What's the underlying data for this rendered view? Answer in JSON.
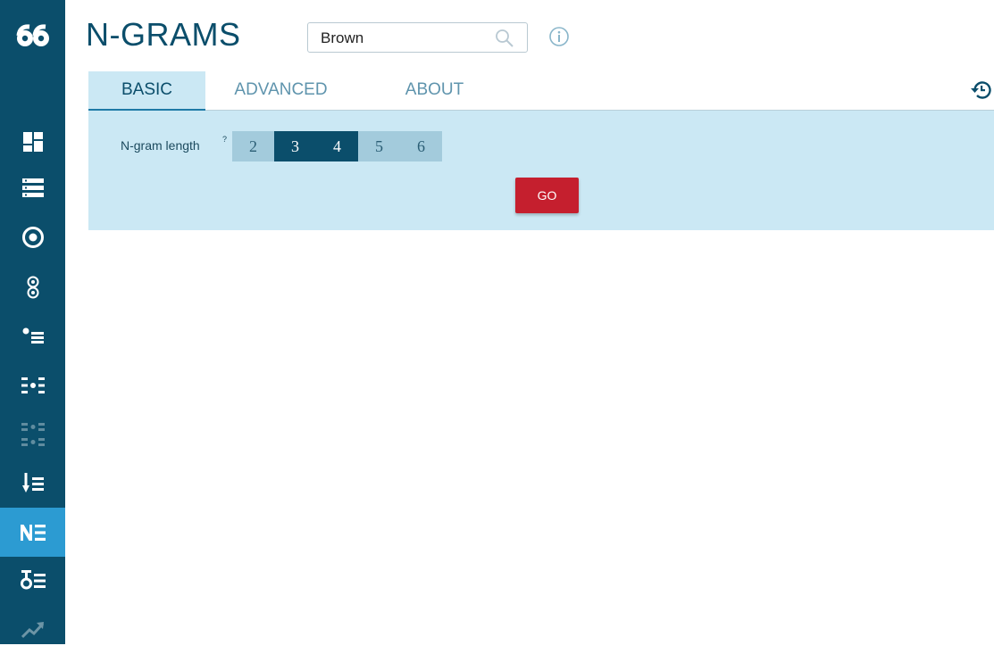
{
  "app": {
    "title": "N-GRAMS"
  },
  "search": {
    "value": "Brown"
  },
  "tabs": [
    {
      "label": "BASIC",
      "active": true
    },
    {
      "label": "ADVANCED",
      "active": false
    },
    {
      "label": "ABOUT",
      "active": false
    }
  ],
  "basic": {
    "ngram_label": "N-gram length",
    "help_mark": "?",
    "lengths": [
      "2",
      "3",
      "4",
      "5",
      "6"
    ],
    "selected_lengths": [
      "3",
      "4"
    ],
    "go_label": "GO"
  },
  "sidebar": {
    "items": [
      {
        "icon": "dashboard-icon"
      },
      {
        "icon": "list-icon"
      },
      {
        "icon": "target-icon"
      },
      {
        "icon": "double-circle-icon"
      },
      {
        "icon": "bullet-list-icon"
      },
      {
        "icon": "dotted-list-icon"
      },
      {
        "icon": "grid-dots-icon",
        "disabled": true
      },
      {
        "icon": "sort-down-list-icon"
      },
      {
        "icon": "ngram-list-icon",
        "active": true
      },
      {
        "icon": "delta-list-icon"
      },
      {
        "icon": "trend-icon",
        "disabled": true
      }
    ]
  },
  "colors": {
    "sidebar": "#0b4e6b",
    "sidebar_active": "#2c9bd2",
    "panel": "#cbe8f4",
    "go_button": "#c51f2e",
    "selected_option": "#0b4e6b",
    "unselected_option": "#a3cbdc"
  }
}
